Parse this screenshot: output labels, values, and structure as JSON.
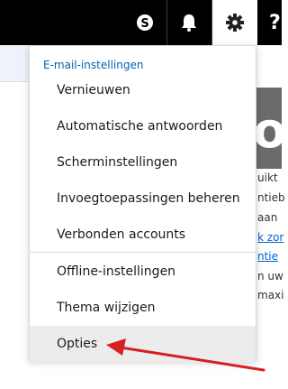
{
  "topbar": {
    "icons": [
      "skype-icon",
      "bell-icon",
      "gear-icon",
      "help-icon"
    ],
    "help_glyph": "?"
  },
  "menu": {
    "header": "E-mail-instellingen",
    "items": [
      {
        "label": "Vernieuwen"
      },
      {
        "label": "Automatische antwoorden"
      },
      {
        "label": "Scherminstellingen"
      },
      {
        "label": "Invoegtoepassingen beheren"
      },
      {
        "label": "Verbonden accounts"
      },
      {
        "label": "Offline-instellingen"
      },
      {
        "label": "Thema wijzigen"
      },
      {
        "label": "Opties"
      }
    ],
    "active_item": "Opties"
  },
  "background": {
    "promo_letter": "o",
    "text_fragments": [
      "uikt",
      "ntieb",
      "aan",
      "k zor",
      "ntie",
      "n uw",
      "maxi"
    ]
  },
  "colors": {
    "topbar": "#000000",
    "accent": "#0063b1",
    "annotation": "#d42020"
  }
}
